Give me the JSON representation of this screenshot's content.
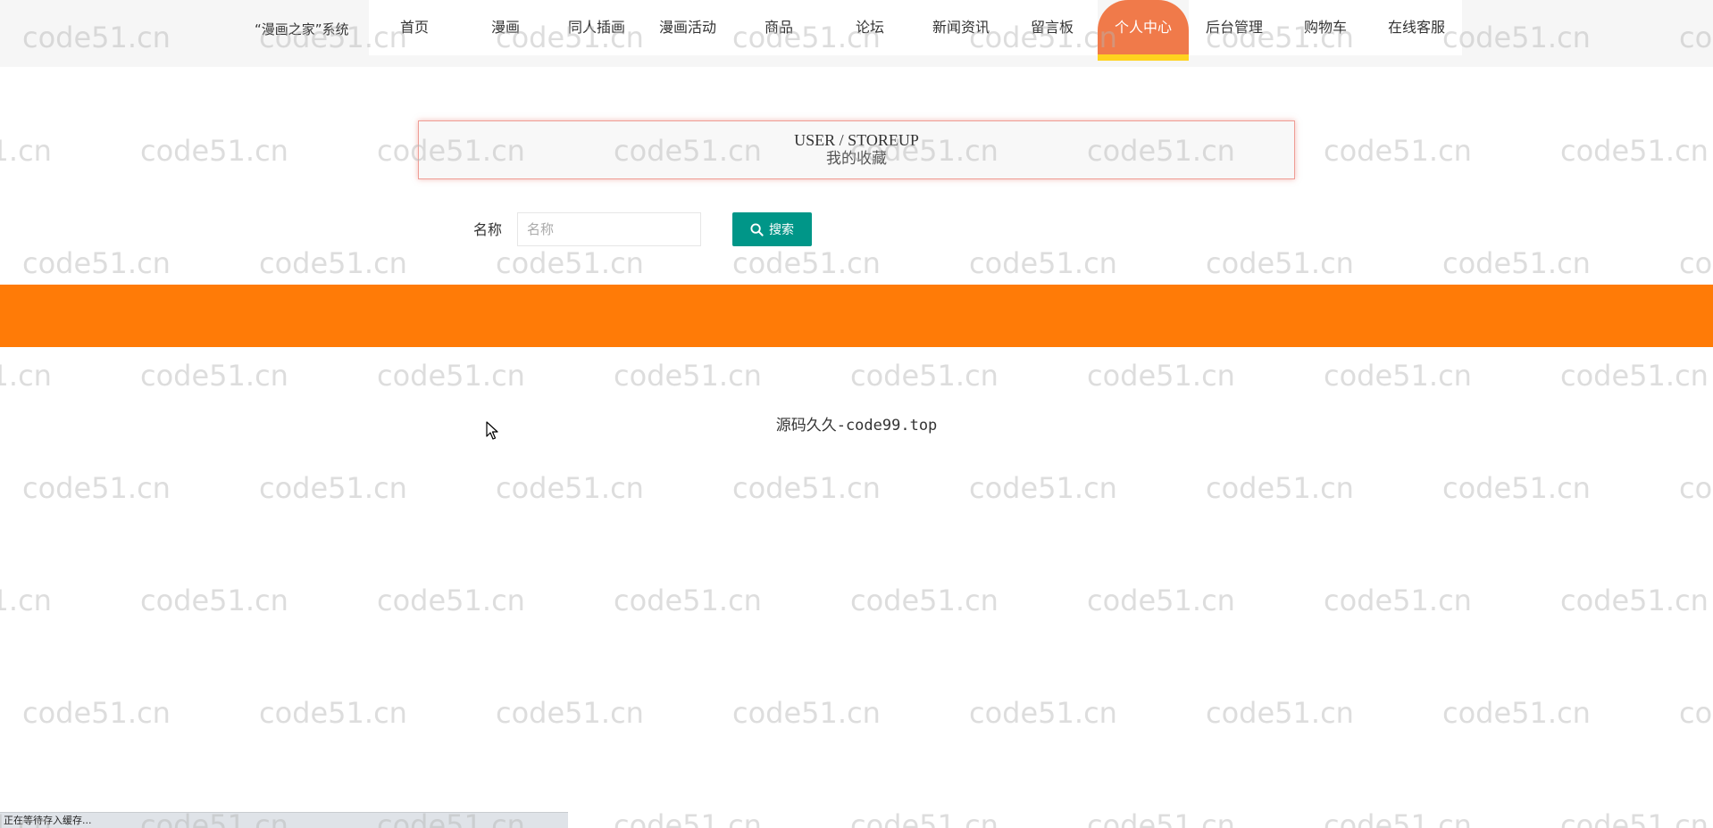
{
  "header": {
    "brand": "“漫画之家”系统",
    "nav": [
      {
        "label": "首页",
        "active": false
      },
      {
        "label": "漫画",
        "active": false
      },
      {
        "label": "同人插画",
        "active": false
      },
      {
        "label": "漫画活动",
        "active": false
      },
      {
        "label": "商品",
        "active": false
      },
      {
        "label": "论坛",
        "active": false
      },
      {
        "label": "新闻资讯",
        "active": false
      },
      {
        "label": "留言板",
        "active": false
      },
      {
        "label": "个人中心",
        "active": true
      },
      {
        "label": "后台管理",
        "active": false
      },
      {
        "label": "购物车",
        "active": false
      },
      {
        "label": "在线客服",
        "active": false
      }
    ],
    "active_color": "#f07a4a",
    "active_underline_color": "#ffd21f"
  },
  "title": {
    "en": "USER / STOREUP",
    "cn": "我的收藏"
  },
  "search": {
    "label": "名称",
    "placeholder": "名称",
    "value": "",
    "button_label": "搜索",
    "button_icon": "search-icon",
    "button_color": "#009688"
  },
  "band": {
    "color": "#ff7b07"
  },
  "footer": {
    "text": "源码久久-code99.top"
  },
  "status_bar": {
    "text": "正在等待存入缓存..."
  },
  "watermark": {
    "text": "code51.cn"
  }
}
